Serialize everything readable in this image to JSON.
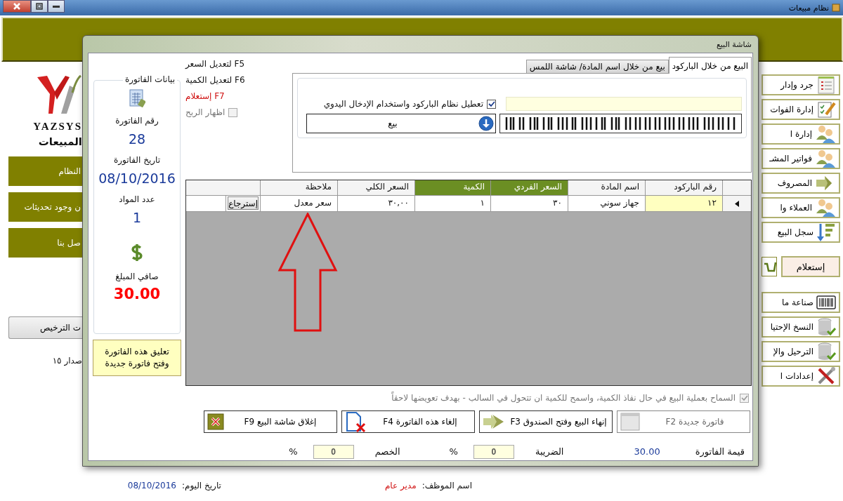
{
  "app_window": {
    "title": "نظام مبيعات"
  },
  "left_panel": {
    "logo_text": "YAZSYS",
    "heading": "المبيعات",
    "menu_buttons": [
      "النظام",
      "ن وجود تحديثات",
      "صل بنا"
    ],
    "license_button": "ت الترخيص",
    "version": "صدار ١٥"
  },
  "right_sidebar": {
    "items": [
      {
        "kind": "nav",
        "label": "جرد وإدار"
      },
      {
        "kind": "nav",
        "label": "إدارة الفوات"
      },
      {
        "kind": "nav",
        "label": "إدارة ا"
      },
      {
        "kind": "nav",
        "label": "فواتير المشـ"
      },
      {
        "kind": "nav",
        "label": "المصروف"
      },
      {
        "kind": "nav",
        "label": "العملاء وا"
      },
      {
        "kind": "nav",
        "label": "سجل البيع"
      },
      {
        "kind": "query",
        "label": "إستعلام"
      },
      {
        "kind": "nav",
        "label": "صناعة ما"
      },
      {
        "kind": "nav",
        "label": "النسخ الإحتيا"
      },
      {
        "kind": "nav",
        "label": "الترحيل والإ"
      },
      {
        "kind": "nav",
        "label": "إعدادات ا"
      }
    ]
  },
  "sale_dialog": {
    "title": "شاشة البيع",
    "invoice_info": {
      "legend": "بيانات الفاتورة",
      "fields": [
        {
          "kind": "plain",
          "label": "رقم الفاتورة",
          "value": "28"
        },
        {
          "kind": "plain",
          "label": "تاريخ الفاتورة",
          "value": "08/10/2016"
        },
        {
          "kind": "plain",
          "label": "عدد المواد",
          "value": "1"
        },
        {
          "kind": "total",
          "label": "صافي المبلغ",
          "value": "30.00"
        }
      ]
    },
    "suspend_button": "تعليق هذه الفاتورة وفتح فاتورة جديدة",
    "shortcuts": [
      {
        "kind": "hint",
        "text": "F5 لتعديل السعر"
      },
      {
        "kind": "hint",
        "text": "F6 لتعديل الكمية"
      },
      {
        "kind": "link",
        "text": "F7 إستعلام"
      }
    ],
    "show_profit": {
      "label": "اظهار الربح",
      "checked": false,
      "disabled": true
    },
    "tabs": [
      {
        "label": "البيع من خلال الباركود",
        "selected": true
      },
      {
        "label": "بيع من خلال اسم المادة/ شاشة اللمس",
        "selected": false
      }
    ],
    "manual_entry": {
      "label": "تعطيل نظام الباركود واستخدام الإدخال اليدوي",
      "checked": true
    },
    "sell_button": "بيع",
    "grid": {
      "columns": [
        {
          "label": "رقم الباركود",
          "highlighted": false
        },
        {
          "label": "اسم المادة",
          "highlighted": false
        },
        {
          "label": "السعر الفردي",
          "highlighted": true
        },
        {
          "label": "الكمية",
          "highlighted": true
        },
        {
          "label": "السعر الكلي",
          "highlighted": false
        },
        {
          "label": "ملاحظة",
          "highlighted": false
        }
      ],
      "rows": [
        {
          "selected": true,
          "cells": [
            "١٢",
            "جهاز سوني",
            "٣٠",
            "١",
            "٣٠,٠٠",
            "سعر معدل"
          ],
          "action": "إسترجاع"
        }
      ]
    },
    "allow_negative": {
      "label": "السماح بعملية البيع في حال نفاذ الكمية، واسمح للكمية ان تتحول في السالب - بهدف تعويضها لاحقاً",
      "checked": true,
      "disabled": true
    },
    "actions": [
      {
        "label": "فاتورة جديدة F2",
        "disabled": true
      },
      {
        "label": "إنهاء البيع وفتح الصندوق F3",
        "disabled": false
      },
      {
        "label": "إلغاء هذه الفاتورة F4",
        "disabled": false
      },
      {
        "label": "إغلاق شاشة البيع F9",
        "disabled": false
      }
    ],
    "totals": {
      "invoice_value_label": "قيمة الفاتورة",
      "invoice_value": "30.00",
      "tax_label": "الضريبة",
      "tax": "0",
      "tax_unit": "%",
      "discount_label": "الخصم",
      "discount": "0",
      "discount_unit": "%"
    }
  },
  "status_bar": {
    "employee_label": "اسم الموظف:",
    "employee": "مدير عام",
    "date_label": "تاريخ اليوم:",
    "date": "08/10/2016"
  }
}
